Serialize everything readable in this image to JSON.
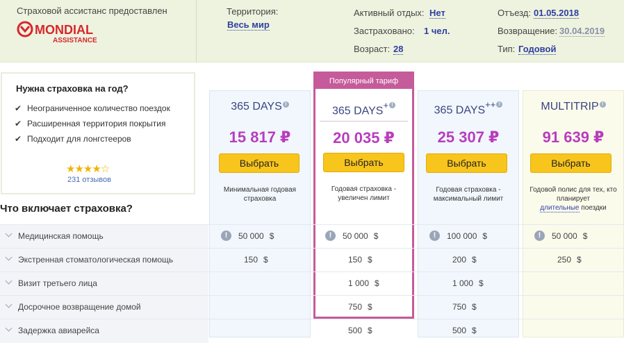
{
  "header": {
    "assistance_label": "Страховой ассистанс предоставлен",
    "logo_text": "MONDIAL",
    "logo_sub": "ASSISTANCE",
    "territory_label": "Территория:",
    "territory_value": "Весь мир",
    "active_label": "Активный отдых:",
    "active_value": "Нет",
    "insured_label": "Застраховано:",
    "insured_value": "1 чел.",
    "age_label": "Возраст:",
    "age_value": "28",
    "departure_label": "Отъезд:",
    "departure_value": "01.05.2018",
    "return_label": "Возвращение:",
    "return_value": "30.04.2019",
    "type_label": "Тип:",
    "type_value": "Годовой",
    "colors": {
      "band": "#eef3df",
      "link": "#2f3fa0",
      "logo_red": "#d7262c"
    }
  },
  "promo": {
    "title": "Нужна страховка на год?",
    "items": [
      "Неограниченное количество поездок",
      "Расширенная территория покрытия",
      "Подходит для лонгстееров"
    ],
    "rating_stars": 4.5,
    "stars_glyphs": "★★★★☆",
    "reviews": "231 отзывов"
  },
  "section_title": "Что включает страховка?",
  "popular_tag": "Популярный тариф",
  "select_label": "Выбрать",
  "plans": [
    {
      "name": "365 DAYS",
      "suffix": "",
      "price": "15 817 ₽",
      "desc": "Минимальная годовая страховка",
      "desc2": "",
      "desc3": ""
    },
    {
      "name": "365 DAYS",
      "suffix": "+",
      "price": "20 035 ₽",
      "desc": "Годовая страховка - увеличен лимит",
      "desc2": "",
      "desc3": ""
    },
    {
      "name": "365 DAYS",
      "suffix": "++",
      "price": "25 307 ₽",
      "desc": "Годовая страховка - максимальный лимит",
      "desc2": "",
      "desc3": ""
    },
    {
      "name": "MULTITRIP",
      "suffix": "",
      "price": "91 639 ₽",
      "desc": "Годовой полис для тех, кто планирует",
      "desc2": "длительные",
      "desc3": "поездки"
    }
  ],
  "rows": [
    {
      "label": "Медицинская помощь",
      "cells": [
        {
          "v": "50 000",
          "c": "$",
          "i": true
        },
        {
          "v": "50 000",
          "c": "$",
          "i": true
        },
        {
          "v": "100 000",
          "c": "$",
          "i": true
        },
        {
          "v": "50 000",
          "c": "$",
          "i": true
        }
      ]
    },
    {
      "label": "Экстренная стоматологическая помощь",
      "cells": [
        {
          "v": "150",
          "c": "$"
        },
        {
          "v": "150",
          "c": "$"
        },
        {
          "v": "200",
          "c": "$"
        },
        {
          "v": "250",
          "c": "$"
        }
      ]
    },
    {
      "label": "Визит третьего лица",
      "cells": [
        {
          "v": "",
          "c": ""
        },
        {
          "v": "1 000",
          "c": "$"
        },
        {
          "v": "1 000",
          "c": "$"
        },
        {
          "v": "",
          "c": ""
        }
      ]
    },
    {
      "label": "Досрочное возвращение домой",
      "cells": [
        {
          "v": "",
          "c": ""
        },
        {
          "v": "750",
          "c": "$"
        },
        {
          "v": "750",
          "c": "$"
        },
        {
          "v": "",
          "c": ""
        }
      ]
    },
    {
      "label": "Задержка авиарейса",
      "cells": [
        {
          "v": "",
          "c": ""
        },
        {
          "v": "500",
          "c": "$"
        },
        {
          "v": "500",
          "c": "$"
        },
        {
          "v": "",
          "c": ""
        }
      ]
    }
  ]
}
